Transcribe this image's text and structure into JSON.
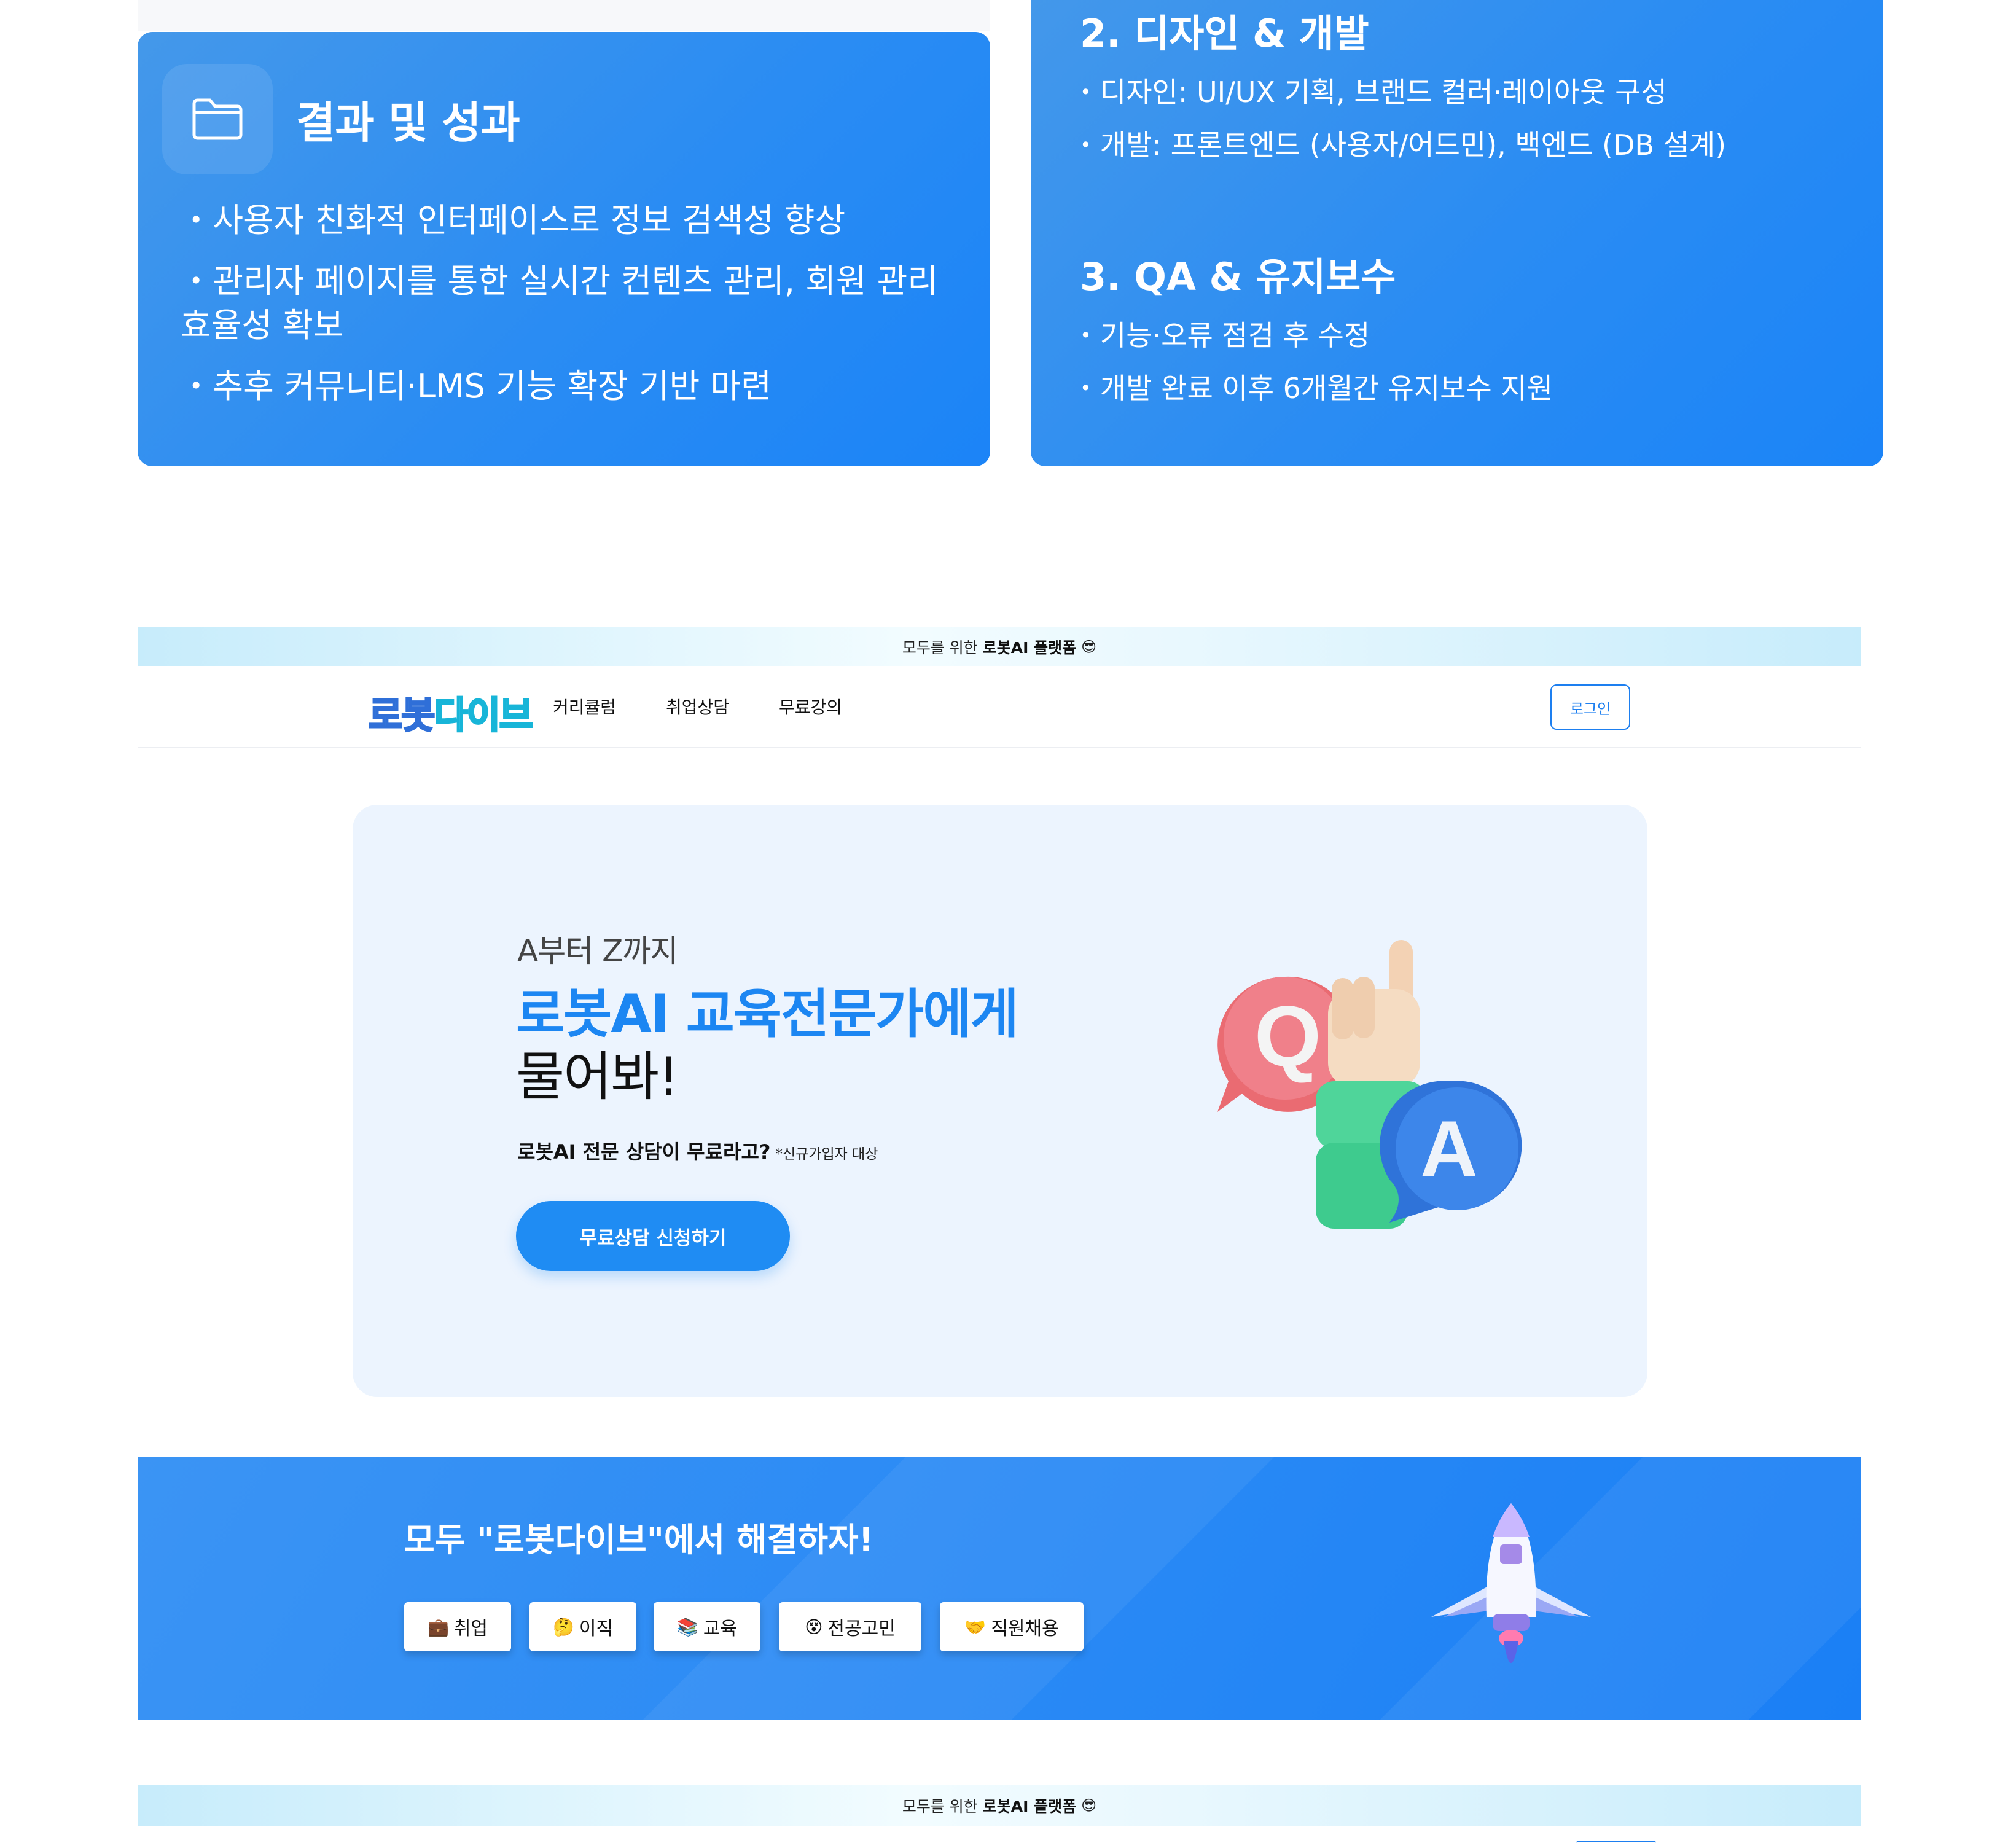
{
  "results_card": {
    "title": "결과 및 성과",
    "bullets": [
      "사용자 친화적 인터페이스로 정보 검색성 향상",
      "관리자 페이지를 통한 실시간 컨텐츠 관리, 회원 관리 효율성 확보",
      "추후 커뮤니티·LMS 기능 확장 기반 마련"
    ]
  },
  "process_card": {
    "sections": [
      {
        "title": "2. 디자인 & 개발",
        "lines": [
          "디자인: UI/UX 기획, 브랜드 컬러·레이아웃 구성",
          "개발: 프론트엔드 (사용자/어드민), 백엔드 (DB 설계)"
        ]
      },
      {
        "title": "3. QA & 유지보수",
        "lines": [
          "기능·오류 점검 후 수정",
          "개발 완료 이후 6개월간 유지보수 지원"
        ]
      }
    ]
  },
  "announcement": {
    "prefix": "모두를 위한",
    "brand": "로봇AI 플랫폼",
    "emoji": "😎"
  },
  "nav": {
    "logo_part1": "로봇",
    "logo_part2": "다이브",
    "items": [
      "커리큘럼",
      "취업상담",
      "무료강의"
    ],
    "login": "로그인"
  },
  "hero": {
    "subtitle": "A부터 Z까지",
    "title_line1": "로봇AI 교육전문가에게",
    "title_line2": "물어봐!",
    "desc": "로봇AI 전문 상담이 무료라고?",
    "desc_note": "*신규가입자 대상",
    "cta": "무료상담 신청하기",
    "q_letter": "Q",
    "a_letter": "A"
  },
  "banner": {
    "title": "모두 \"로봇다이브\"에서 해결하자!",
    "chips": [
      {
        "icon": "💼",
        "label": "취업"
      },
      {
        "icon": "🤔",
        "label": "이직"
      },
      {
        "icon": "📚",
        "label": "교육"
      },
      {
        "icon": "😵",
        "label": "전공고민"
      },
      {
        "icon": "🤝",
        "label": "직원채용"
      }
    ]
  },
  "colors": {
    "primary": "#1f8cf3",
    "hero_bg": "#ecf4fe",
    "card_blue": "#2a8cf3"
  }
}
